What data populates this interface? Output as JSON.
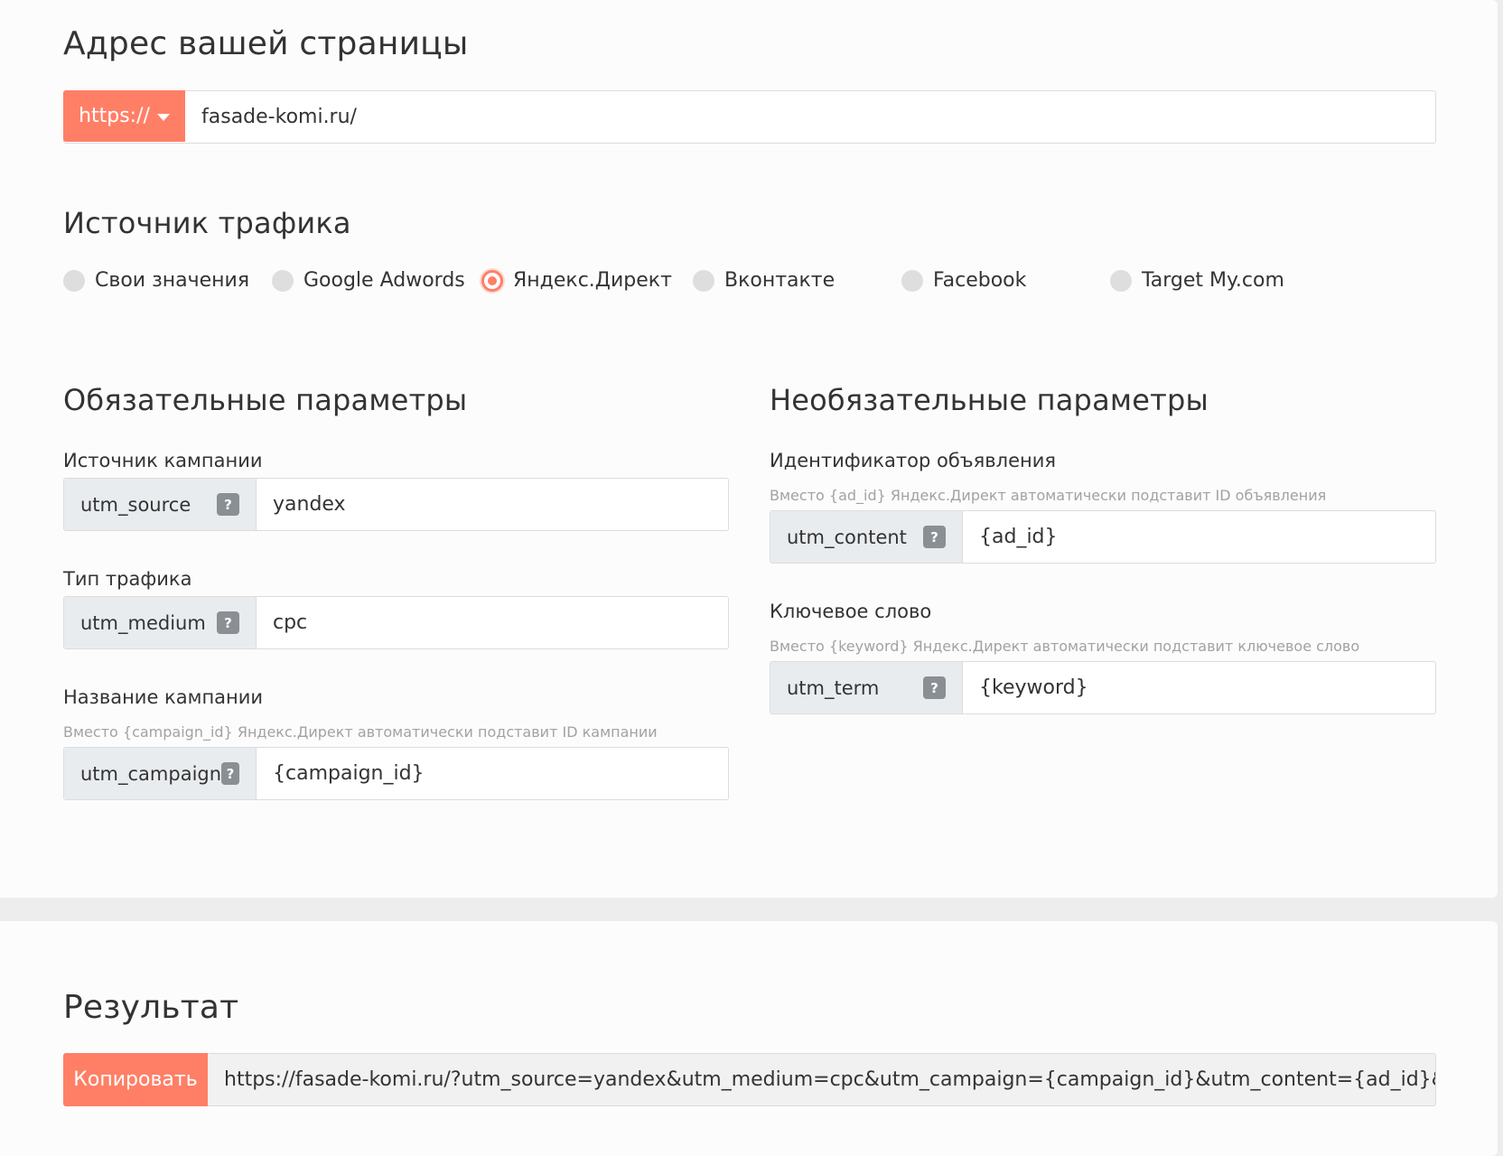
{
  "address": {
    "title": "Адрес вашей страницы",
    "protocol": "https://",
    "url": "fasade-komi.ru/"
  },
  "traffic_source": {
    "title": "Источник трафика",
    "options": [
      {
        "label": "Свои значения",
        "checked": false
      },
      {
        "label": "Google Adwords",
        "checked": false
      },
      {
        "label": "Яндекс.Директ",
        "checked": true
      },
      {
        "label": "Вконтакте",
        "checked": false
      },
      {
        "label": "Facebook",
        "checked": false
      },
      {
        "label": "Target My.com",
        "checked": false
      }
    ]
  },
  "required": {
    "title": "Обязательные параметры",
    "fields": [
      {
        "label": "Источник кампании",
        "hint": "",
        "param": "utm_source",
        "value": "yandex"
      },
      {
        "label": "Тип трафика",
        "hint": "",
        "param": "utm_medium",
        "value": "cpc"
      },
      {
        "label": "Название кампании",
        "hint": "Вместо {campaign_id} Яндекс.Директ автоматически подставит ID кампании",
        "param": "utm_campaign",
        "value": "{campaign_id}"
      }
    ]
  },
  "optional": {
    "title": "Необязательные параметры",
    "fields": [
      {
        "label": "Идентификатор объявления",
        "hint": "Вместо {ad_id} Яндекс.Директ автоматически подставит ID объявления",
        "param": "utm_content",
        "value": "{ad_id}"
      },
      {
        "label": "Ключевое слово",
        "hint": "Вместо {keyword} Яндекс.Директ автоматически подставит ключевое слово",
        "param": "utm_term",
        "value": "{keyword}"
      }
    ]
  },
  "result": {
    "title": "Результат",
    "copy_label": "Копировать",
    "url": "https://fasade-komi.ru/?utm_source=yandex&utm_medium=cpc&utm_campaign={campaign_id}&utm_content={ad_id}&utm_term={keyword}"
  },
  "help_glyph": "?",
  "colors": {
    "accent": "#ff7f66",
    "addon_bg": "#e9ecef",
    "help_icon_bg": "#8a8f94",
    "hint_text": "#a2a2a2"
  }
}
